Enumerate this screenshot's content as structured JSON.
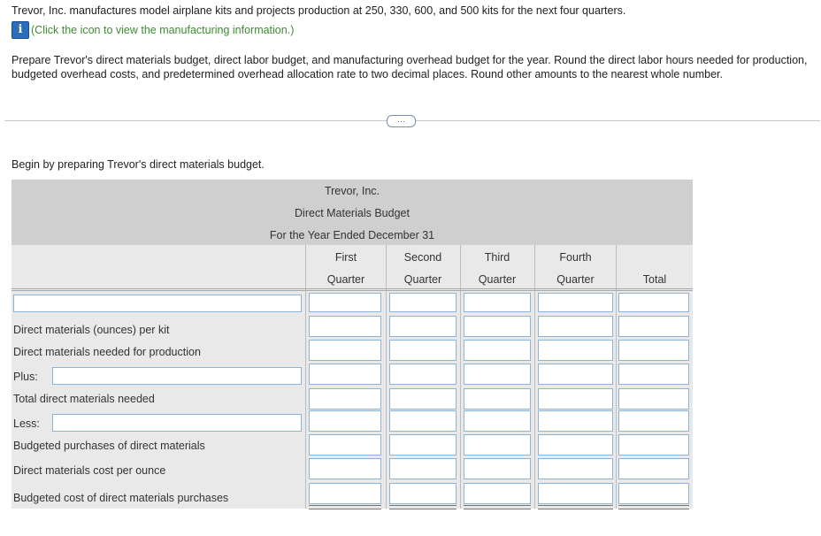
{
  "intro": {
    "text": "Trevor, Inc. manufactures model airplane kits and projects production at 250, 330, 600, and 500 kits for the next four quarters.",
    "info_link": "(Click the icon to view the manufacturing information.)",
    "info_icon": "info-icon",
    "instructions": "Prepare Trevor's direct materials budget, direct labor budget, and manufacturing overhead budget for the year. Round the direct labor hours needed for production, budgeted overhead costs, and predetermined overhead allocation rate to two decimal places. Round other amounts to the nearest whole number."
  },
  "more_button": "…",
  "prompt": "Begin by preparing Trevor's direct materials budget.",
  "budget": {
    "company": "Trevor, Inc.",
    "title": "Direct Materials Budget",
    "period": "For the Year Ended December 31",
    "columns": [
      {
        "top": "First",
        "bottom": "Quarter"
      },
      {
        "top": "Second",
        "bottom": "Quarter"
      },
      {
        "top": "Third",
        "bottom": "Quarter"
      },
      {
        "top": "Fourth",
        "bottom": "Quarter"
      },
      {
        "top": "",
        "bottom": "Total"
      }
    ],
    "rows": {
      "r1": "",
      "r2": "Direct materials (ounces) per kit",
      "r3": "Direct materials needed for production",
      "r4": "Plus:",
      "r5": "Total direct materials needed",
      "r6": "Less:",
      "r7": "Budgeted purchases of direct materials",
      "r8": "Direct materials cost per ounce",
      "r9": "Budgeted cost of direct materials purchases"
    }
  },
  "colors": {
    "header_bg": "#cfcfcf",
    "table_bg": "#e9e9e9",
    "link": "#3c8e31",
    "input_border": "#8fb3d4"
  }
}
